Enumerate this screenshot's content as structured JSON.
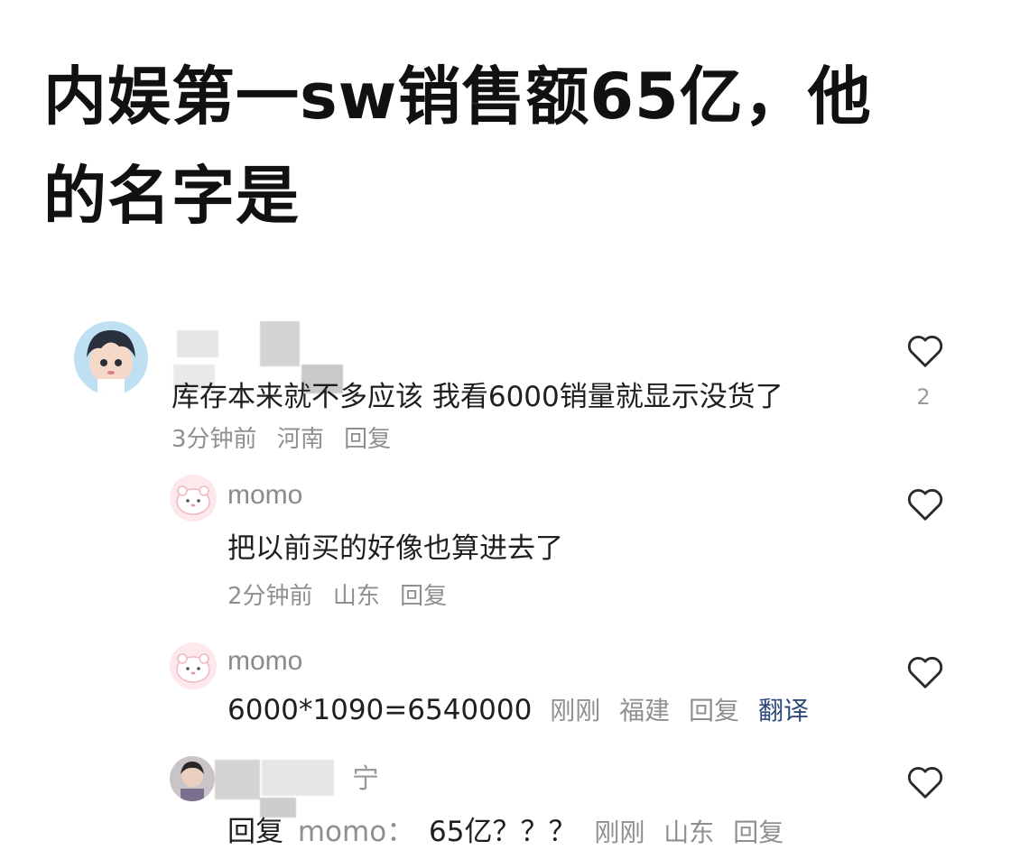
{
  "post": {
    "title_line1": "内娱第一sw销售额65亿，他",
    "title_line2": "的名字是"
  },
  "comments": [
    {
      "text": "库存本来就不多应该 我看6000销量就显示没货了",
      "time": "3分钟前",
      "location": "河南",
      "reply_label": "回复",
      "like_count": "2",
      "avatar_icon": "anime-girl-avatar-icon"
    },
    {
      "name": "momo",
      "text": "把以前买的好像也算进去了",
      "time": "2分钟前",
      "location": "山东",
      "reply_label": "回复",
      "avatar_icon": "pink-bear-avatar-icon"
    },
    {
      "name": "momo",
      "text": "6000*1090=6540000",
      "time": "刚刚",
      "location": "福建",
      "reply_label": "回复",
      "translate_label": "翻译",
      "avatar_icon": "pink-bear-avatar-icon"
    },
    {
      "name_visible": "宁",
      "reply_prefix": "回复",
      "reply_to": "momo：",
      "text": "65亿？？？",
      "time": "刚刚",
      "location": "山东",
      "reply_label": "回复",
      "avatar_icon": "person-photo-avatar-icon"
    }
  ],
  "icons": {
    "like": "heart-outline-icon"
  },
  "colors": {
    "title": "#111111",
    "meta": "#8f8f8f",
    "translate": "#2f4a7a"
  }
}
